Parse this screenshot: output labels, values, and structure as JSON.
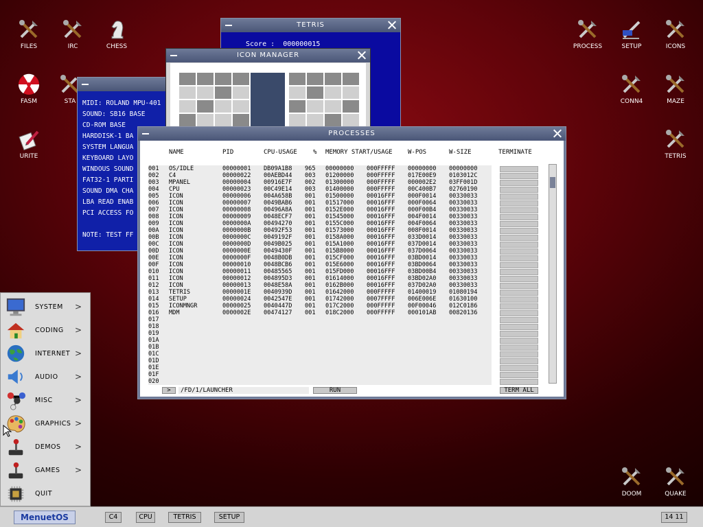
{
  "desktop_icons": {
    "files": "FILES",
    "irc": "IRC",
    "chess": "CHESS",
    "fasm": "FASM",
    "sta": "STA",
    "write": "URITE",
    "process": "PROCESS",
    "setup": "SETUP",
    "icons": "ICONS",
    "conn4": "CONN4",
    "maze": "MAZE",
    "tetris": "TETRIS",
    "doom": "DOOM",
    "quake": "QUAKE"
  },
  "tetris_window": {
    "title": "TETRIS",
    "score_label": "Score :",
    "score_value": "000000015"
  },
  "icon_manager_window": {
    "title": "ICON MANAGER"
  },
  "info_window": {
    "lines": [
      "MIDI: ROLAND MPU-401",
      "SOUND: SB16 BASE",
      "CD-ROM BASE",
      "HARDDISK-1 BA",
      "SYSTEM LANGUA",
      "KEYBOARD LAYO",
      "WINDOUS SOUND",
      "FAT32-1 PARTI",
      "SOUND DMA CHA",
      "LBA READ ENAB",
      "PCI ACCESS FO",
      "",
      "NOTE: TEST FF"
    ]
  },
  "processes_window": {
    "title": "PROCESSES",
    "headers": {
      "name": "NAME",
      "pid": "PID",
      "cpu": "CPU-USAGE",
      "pct": "%",
      "mem": "MEMORY START/USAGE",
      "wpos": "W-POS",
      "wsize": "W-SIZE",
      "terminate": "TERMINATE"
    },
    "rows": [
      {
        "n": "001",
        "name": "OS/IDLE",
        "pid": "00000001",
        "cpu": "DB09A1B8",
        "pct": "965",
        "ms": "00000000",
        "mu": "000FFFFF",
        "wp": "00000000",
        "ws": "00000000"
      },
      {
        "n": "002",
        "name": "C4",
        "pid": "00000022",
        "cpu": "00AEBD44",
        "pct": "003",
        "ms": "01200000",
        "mu": "000FFFFF",
        "wp": "017E00E9",
        "ws": "0103012C"
      },
      {
        "n": "003",
        "name": "MPANEL",
        "pid": "00000004",
        "cpu": "00916E7F",
        "pct": "002",
        "ms": "01300000",
        "mu": "000FFFFF",
        "wp": "000002E2",
        "ws": "03FF001D"
      },
      {
        "n": "004",
        "name": "CPU",
        "pid": "00000023",
        "cpu": "00C49E14",
        "pct": "003",
        "ms": "01400000",
        "mu": "000FFFFF",
        "wp": "00C400B7",
        "ws": "02760190"
      },
      {
        "n": "005",
        "name": "ICON",
        "pid": "00000006",
        "cpu": "004A658B",
        "pct": "001",
        "ms": "01500000",
        "mu": "00016FFF",
        "wp": "000F0014",
        "ws": "00330033"
      },
      {
        "n": "006",
        "name": "ICON",
        "pid": "00000007",
        "cpu": "0049BAB6",
        "pct": "001",
        "ms": "01517000",
        "mu": "00016FFF",
        "wp": "000F0064",
        "ws": "00330033"
      },
      {
        "n": "007",
        "name": "ICON",
        "pid": "00000008",
        "cpu": "00496A8A",
        "pct": "001",
        "ms": "0152E000",
        "mu": "00016FFF",
        "wp": "000F00B4",
        "ws": "00330033"
      },
      {
        "n": "008",
        "name": "ICON",
        "pid": "00000009",
        "cpu": "0048ECF7",
        "pct": "001",
        "ms": "01545000",
        "mu": "00016FFF",
        "wp": "004F0014",
        "ws": "00330033"
      },
      {
        "n": "009",
        "name": "ICON",
        "pid": "0000000A",
        "cpu": "00494270",
        "pct": "001",
        "ms": "0155C000",
        "mu": "00016FFF",
        "wp": "004F0064",
        "ws": "00330033"
      },
      {
        "n": "00A",
        "name": "ICON",
        "pid": "0000000B",
        "cpu": "00492F53",
        "pct": "001",
        "ms": "01573000",
        "mu": "00016FFF",
        "wp": "008F0014",
        "ws": "00330033"
      },
      {
        "n": "00B",
        "name": "ICON",
        "pid": "0000000C",
        "cpu": "0049192F",
        "pct": "001",
        "ms": "0158A000",
        "mu": "00016FFF",
        "wp": "033D0014",
        "ws": "00330033"
      },
      {
        "n": "00C",
        "name": "ICON",
        "pid": "0000000D",
        "cpu": "0049B025",
        "pct": "001",
        "ms": "015A1000",
        "mu": "00016FFF",
        "wp": "037D0014",
        "ws": "00330033"
      },
      {
        "n": "00D",
        "name": "ICON",
        "pid": "0000000E",
        "cpu": "0049430F",
        "pct": "001",
        "ms": "015B8000",
        "mu": "00016FFF",
        "wp": "037D0064",
        "ws": "00330033"
      },
      {
        "n": "00E",
        "name": "ICON",
        "pid": "0000000F",
        "cpu": "0048B0DB",
        "pct": "001",
        "ms": "015CF000",
        "mu": "00016FFF",
        "wp": "03BD0014",
        "ws": "00330033"
      },
      {
        "n": "00F",
        "name": "ICON",
        "pid": "00000010",
        "cpu": "0048BCB6",
        "pct": "001",
        "ms": "015E6000",
        "mu": "00016FFF",
        "wp": "03BD0064",
        "ws": "00330033"
      },
      {
        "n": "010",
        "name": "ICON",
        "pid": "00000011",
        "cpu": "00485565",
        "pct": "001",
        "ms": "015FD000",
        "mu": "00016FFF",
        "wp": "03BD00B4",
        "ws": "00330033"
      },
      {
        "n": "011",
        "name": "ICON",
        "pid": "00000012",
        "cpu": "004895D3",
        "pct": "001",
        "ms": "01614000",
        "mu": "00016FFF",
        "wp": "03BD02A0",
        "ws": "00330033"
      },
      {
        "n": "012",
        "name": "ICON",
        "pid": "00000013",
        "cpu": "0048E58A",
        "pct": "001",
        "ms": "0162B000",
        "mu": "00016FFF",
        "wp": "037D02A0",
        "ws": "00330033"
      },
      {
        "n": "013",
        "name": "TETRIS",
        "pid": "0000001E",
        "cpu": "0040939D",
        "pct": "001",
        "ms": "01642000",
        "mu": "000FFFFF",
        "wp": "01400019",
        "ws": "01080194"
      },
      {
        "n": "014",
        "name": "SETUP",
        "pid": "00000024",
        "cpu": "0042547E",
        "pct": "001",
        "ms": "01742000",
        "mu": "0007FFFF",
        "wp": "006E006E",
        "ws": "01630100"
      },
      {
        "n": "015",
        "name": "ICONMNGR",
        "pid": "00000025",
        "cpu": "0040447D",
        "pct": "001",
        "ms": "017C2000",
        "mu": "000FFFFF",
        "wp": "00F00046",
        "ws": "012C0186"
      },
      {
        "n": "016",
        "name": "MDM",
        "pid": "0000002E",
        "cpu": "00474127",
        "pct": "001",
        "ms": "018C2000",
        "mu": "000FFFFF",
        "wp": "000101AB",
        "ws": "00820136"
      },
      {
        "n": "017"
      },
      {
        "n": "018"
      },
      {
        "n": "019"
      },
      {
        "n": "01A"
      },
      {
        "n": "01B"
      },
      {
        "n": "01C"
      },
      {
        "n": "01D"
      },
      {
        "n": "01E"
      },
      {
        "n": "01F"
      },
      {
        "n": "020"
      }
    ],
    "path_button": ">",
    "path": "/FD/1/LAUNCHER",
    "run": "RUN",
    "term_all": "TERM ALL"
  },
  "launcher": {
    "items": [
      {
        "id": "system",
        "label": "SYSTEM",
        "icon": "monitor-icon"
      },
      {
        "id": "coding",
        "label": "CODING",
        "icon": "house-icon"
      },
      {
        "id": "internet",
        "label": "INTERNET",
        "icon": "globe-icon"
      },
      {
        "id": "audio",
        "label": "AUDIO",
        "icon": "speaker-icon"
      },
      {
        "id": "misc",
        "label": "MISC",
        "icon": "molecule-icon"
      },
      {
        "id": "graphics",
        "label": "GRAPHICS",
        "icon": "palette-icon"
      },
      {
        "id": "demos",
        "label": "DEMOS",
        "icon": "joystick-icon"
      },
      {
        "id": "games",
        "label": "GAMES",
        "icon": "joystick-icon"
      },
      {
        "id": "quit",
        "label": "QUIT",
        "icon": "chip-icon"
      }
    ],
    "arrow": ">"
  },
  "taskbar": {
    "menu": "MenuetOS",
    "tasks": [
      "C4",
      "CPU",
      "TETRIS",
      "SETUP"
    ],
    "clock": "14 11"
  }
}
